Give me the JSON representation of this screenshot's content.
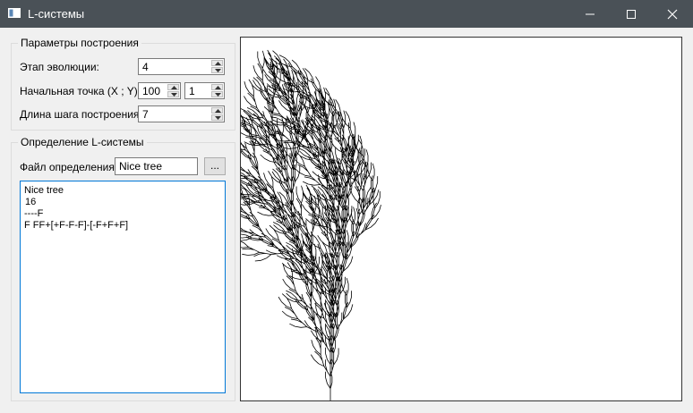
{
  "window": {
    "title": "L-системы",
    "buttons": [
      "minimize-icon",
      "maximize-icon",
      "close-icon"
    ]
  },
  "params": {
    "title": "Параметры построения",
    "evolution_label": "Этап эволюции:",
    "evolution_value": "4",
    "start_label": "Начальная точка (X ; Y):",
    "start_x": "100",
    "start_y": "1",
    "step_label": "Длина шага построения:",
    "step_value": "7"
  },
  "definition": {
    "title": "Определение L-системы",
    "file_label": "Файл определения:",
    "file_value": "Nice tree",
    "browse_label": "...",
    "lines": [
      "Nice tree",
      "16",
      "----F",
      "F FF+[+F-F-F]-[-F+F+F]"
    ]
  },
  "canvas": {
    "content": "L-system tree drawing",
    "stroke_color": "#000000"
  }
}
